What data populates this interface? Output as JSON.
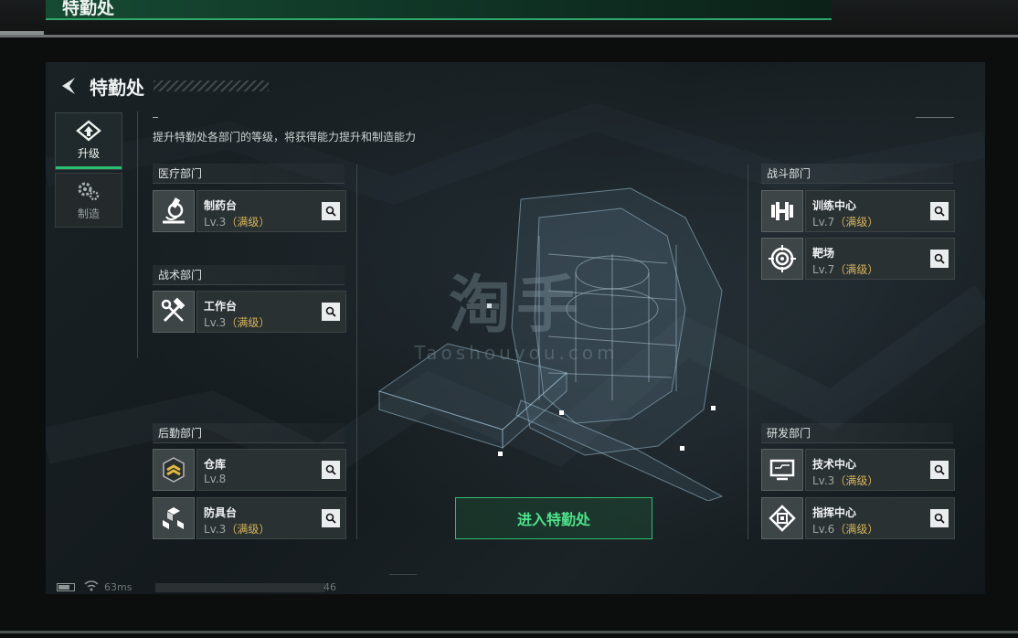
{
  "topbar": {
    "title": "特勤处"
  },
  "header": {
    "title": "特勤处"
  },
  "sidebar": {
    "tabs": [
      {
        "label": "升级",
        "icon": "upgrade-icon",
        "active": true
      },
      {
        "label": "制造",
        "icon": "craft-gears-icon",
        "active": false
      }
    ]
  },
  "intro": "提升特勤处各部门的等级，将获得能力提升和制造能力",
  "departments": {
    "medical": {
      "title": "医疗部门",
      "items": [
        {
          "name": "制药台",
          "level": "Lv.3",
          "status": "（满级）",
          "icon": "microscope-icon"
        }
      ]
    },
    "tactical": {
      "title": "战术部门",
      "items": [
        {
          "name": "工作台",
          "level": "Lv.3",
          "status": "（满级）",
          "icon": "hammer-wrench-icon"
        }
      ]
    },
    "logistics": {
      "title": "后勤部门",
      "items": [
        {
          "name": "仓库",
          "level": "Lv.8",
          "status": "",
          "icon": "rank-chevron-icon"
        },
        {
          "name": "防具台",
          "level": "Lv.3",
          "status": "（满级）",
          "icon": "cubes-icon"
        }
      ]
    },
    "combat": {
      "title": "战斗部门",
      "items": [
        {
          "name": "训练中心",
          "level": "Lv.7",
          "status": "（满级）",
          "icon": "dumbbell-icon"
        },
        {
          "name": "靶场",
          "level": "Lv.7",
          "status": "（满级）",
          "icon": "target-icon"
        }
      ]
    },
    "research": {
      "title": "研发部门",
      "items": [
        {
          "name": "技术中心",
          "level": "Lv.3",
          "status": "（满级）",
          "icon": "monitor-icon"
        },
        {
          "name": "指挥中心",
          "level": "Lv.6",
          "status": "（满级）",
          "icon": "command-chip-icon"
        }
      ]
    }
  },
  "enter_button": "进入特勤处",
  "watermark": {
    "main": "淘手",
    "sub": "Taoshouyou.com"
  },
  "status": {
    "ping": "63ms",
    "number": "46"
  },
  "colors": {
    "accent": "#2bc06f",
    "maxed": "#d6b45a",
    "panel": "#1a2226"
  }
}
